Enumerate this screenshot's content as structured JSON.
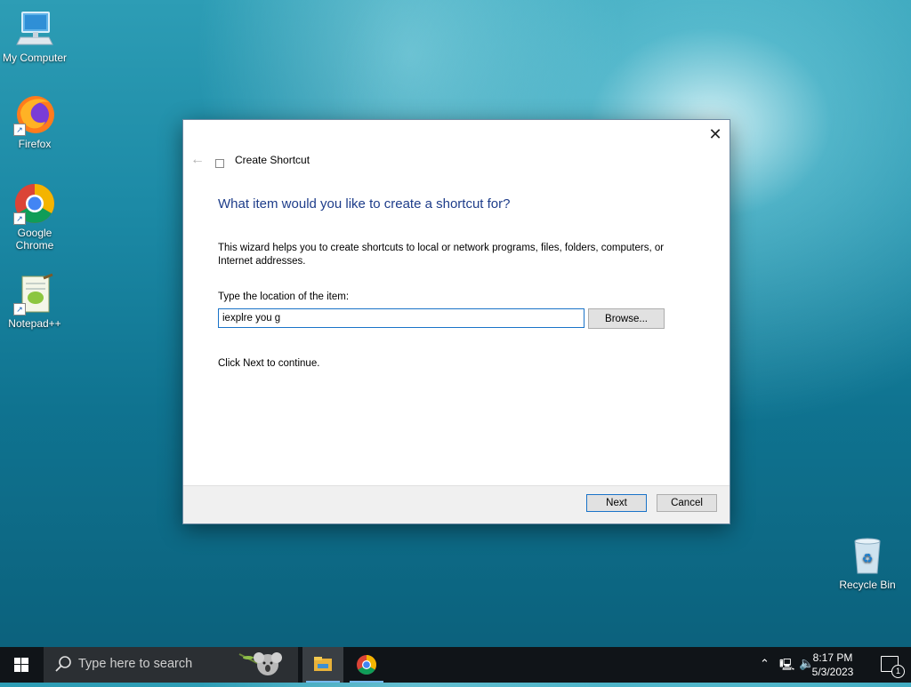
{
  "desktop": {
    "icons": [
      {
        "label": "My Computer"
      },
      {
        "label": "Firefox"
      },
      {
        "label": "Google Chrome"
      },
      {
        "label": "Notepad++"
      },
      {
        "label": "Recycle Bin"
      }
    ]
  },
  "dialog": {
    "window_title": "Create Shortcut",
    "heading": "What item would you like to create a shortcut for?",
    "description": "This wizard helps you to create shortcuts to local or network programs, files, folders, computers, or Internet addresses.",
    "field_label": "Type the location of the item:",
    "location_value": "iexplre you g",
    "browse_label": "Browse...",
    "continue_text": "Click Next to continue.",
    "next_label": "Next",
    "cancel_label": "Cancel"
  },
  "taskbar": {
    "search_placeholder": "Type here to search",
    "time": "8:17 PM",
    "date": "5/3/2023",
    "notification_count": "1"
  },
  "colors": {
    "heading": "#1e3d8a",
    "accent": "#1a73c8",
    "taskbar": "#101418"
  }
}
